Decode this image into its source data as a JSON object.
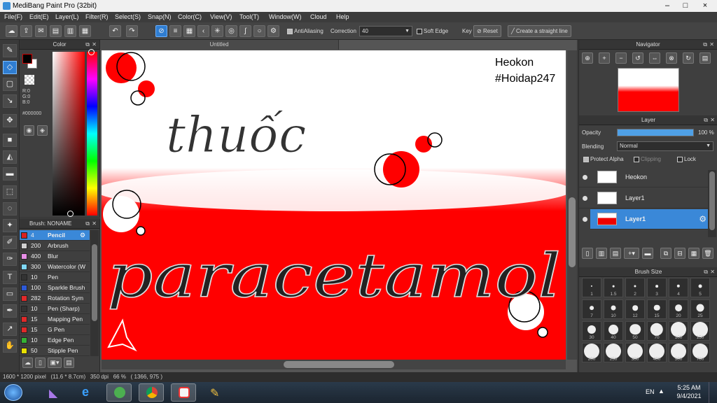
{
  "window": {
    "title": "MediBang Paint Pro (32bit)",
    "controls": [
      "–",
      "□",
      "×"
    ]
  },
  "menu": [
    "File(F)",
    "Edit(E)",
    "Layer(L)",
    "Filter(R)",
    "Select(S)",
    "Snap(N)",
    "Color(C)",
    "View(V)",
    "Tool(T)",
    "Window(W)",
    "Cloud",
    "Help"
  ],
  "toolbar": {
    "antialiasing_label": "AntiAliasing",
    "correction_label": "Correction",
    "correction_value": "40",
    "soft_edge_label": "Soft Edge",
    "key_label": "Key",
    "reset_label": "Reset",
    "straight_line_label": "Create a straight line"
  },
  "color_panel": {
    "title": "Color",
    "r": "R:0",
    "g": "G:0",
    "b": "B:0",
    "hex": "#000000"
  },
  "brush_panel": {
    "title": "Brush: NONAME",
    "items": [
      {
        "size": "4",
        "name": "Pencil",
        "color": "#d92020"
      },
      {
        "size": "200",
        "name": "Arbrush",
        "color": "#d0d0d0"
      },
      {
        "size": "400",
        "name": "Blur",
        "color": "#e78ee6"
      },
      {
        "size": "300",
        "name": "Watercolor (W",
        "color": "#7fd8f7"
      },
      {
        "size": "10",
        "name": "Pen",
        "color": "#333333"
      },
      {
        "size": "100",
        "name": "Sparkle Brush",
        "color": "#2d59d6"
      },
      {
        "size": "282",
        "name": "Rotation Sym",
        "color": "#e02a2a"
      },
      {
        "size": "10",
        "name": "Pen (Sharp)",
        "color": "#333333"
      },
      {
        "size": "15",
        "name": "Mapping Pen",
        "color": "#e02a2a"
      },
      {
        "size": "15",
        "name": "G Pen",
        "color": "#e02a2a"
      },
      {
        "size": "10",
        "name": "Edge Pen",
        "color": "#35b135"
      },
      {
        "size": "50",
        "name": "Stipple Pen",
        "color": "#e8e000"
      }
    ]
  },
  "document": {
    "tab_title": "Untitled",
    "artwork_text": {
      "line1": "Heokon",
      "line2": "#Hoidap247",
      "word1": "thuốc",
      "word2": "paracetamol"
    }
  },
  "navigator": {
    "title": "Navigator"
  },
  "layer_panel": {
    "title": "Layer",
    "opacity_label": "Opacity",
    "opacity_value": "100 %",
    "opacity_fraction": 1.0,
    "blending_label": "Blending",
    "blending_value": "Normal",
    "protect_alpha_label": "Protect Alpha",
    "clipping_label": "Clipping",
    "lock_label": "Lock",
    "layers": [
      {
        "name": "Heokon"
      },
      {
        "name": "Layer1"
      },
      {
        "name": "Layer1"
      }
    ]
  },
  "brush_size_panel": {
    "title": "Brush Size",
    "sizes": [
      "1",
      "1.5",
      "2",
      "3",
      "4",
      "5",
      "7",
      "10",
      "12",
      "15",
      "20",
      "25",
      "30",
      "40",
      "50",
      "70",
      "100",
      "150",
      "200",
      "250",
      "300",
      "400",
      "500",
      "700"
    ]
  },
  "status": {
    "text": "1600 * 1200 pixel   (11.6 * 8.7cm)   350 dpi   66 %   ( 1366, 975 )"
  },
  "taskbar": {
    "language": "EN",
    "time": "5:25 AM",
    "date": "9/4/2021"
  },
  "colors": {
    "accent": "#3a88d8",
    "canvas_red": "#ff0000"
  }
}
